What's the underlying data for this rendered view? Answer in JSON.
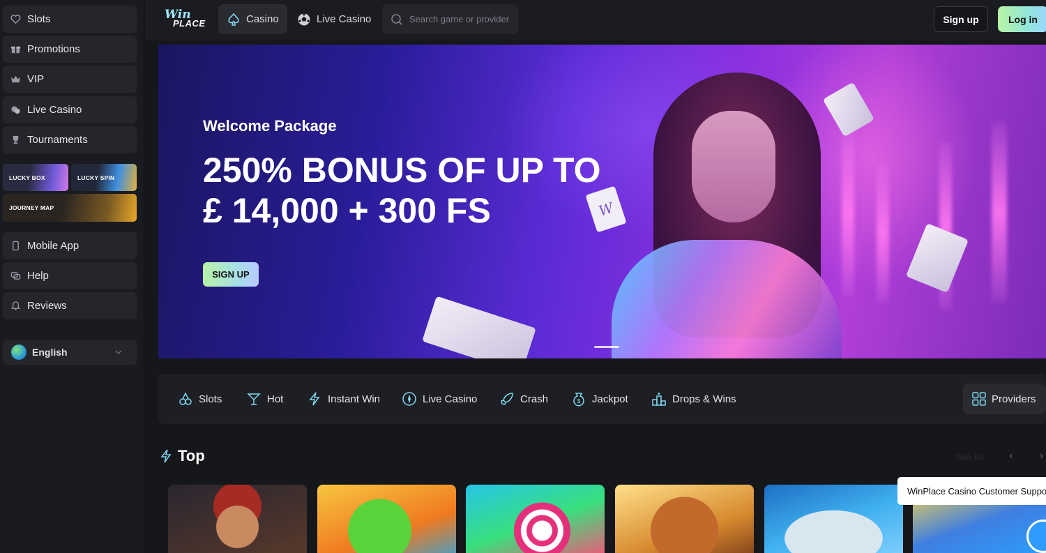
{
  "sidebar": {
    "items_top": [
      {
        "label": "Slots",
        "icon": "heart-icon"
      },
      {
        "label": "Promotions",
        "icon": "gift-icon"
      },
      {
        "label": "VIP",
        "icon": "crown-icon"
      },
      {
        "label": "Live Casino",
        "icon": "chips-icon"
      },
      {
        "label": "Tournaments",
        "icon": "trophy-icon"
      }
    ],
    "tiles": {
      "lucky_box": "LUCKY BOX",
      "lucky_spin": "LUCKY SPIN",
      "journey_map": "JOURNEY MAP"
    },
    "items_bottom": [
      {
        "label": "Mobile App",
        "icon": "phone-icon"
      },
      {
        "label": "Help",
        "icon": "chat-bubbles-icon"
      },
      {
        "label": "Reviews",
        "icon": "bell-icon"
      }
    ],
    "language": "English"
  },
  "header": {
    "logo_top": "Win",
    "logo_bottom": "PLACE",
    "tabs": [
      {
        "label": "Casino",
        "icon": "spade-icon"
      },
      {
        "label": "Live Casino",
        "icon": "soccer-ball-icon"
      }
    ],
    "search_placeholder": "Search game or provider",
    "signup_label": "Sign up",
    "login_label": "Log in"
  },
  "hero": {
    "kicker": "Welcome Package",
    "title_line1": "250% BONUS OF UP TO",
    "title_line2": "£ 14,000 + 300 FS",
    "cta": "SIGN UP",
    "card_letter": "W"
  },
  "categories": [
    {
      "label": "Slots",
      "icon": "cherries-icon"
    },
    {
      "label": "Hot",
      "icon": "cocktail-icon"
    },
    {
      "label": "Instant Win",
      "icon": "lightning-icon"
    },
    {
      "label": "Live Casino",
      "icon": "compass-icon"
    },
    {
      "label": "Crash",
      "icon": "rocket-icon"
    },
    {
      "label": "Jackpot",
      "icon": "money-bag-icon"
    },
    {
      "label": "Drops & Wins",
      "icon": "podium-icon"
    }
  ],
  "providers_label": "Providers",
  "top_section": {
    "title": "Top",
    "see_all": "See All",
    "prev": "‹",
    "next": "›"
  },
  "chat": {
    "popup_text": "WinPlace Casino Customer Support"
  },
  "colors": {
    "accent_gradient_start": "#b6f5a4",
    "accent_gradient_end": "#9bd6ff",
    "icon_accent": "#7fd9f0",
    "background": "#16171b"
  }
}
